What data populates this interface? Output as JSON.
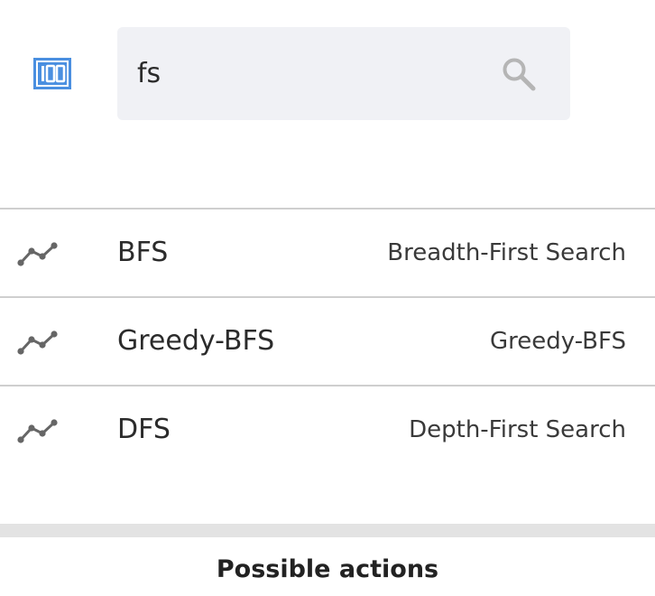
{
  "search": {
    "value": "fs",
    "placeholder": ""
  },
  "results": [
    {
      "name": "BFS",
      "description": "Breadth-First Search"
    },
    {
      "name": "Greedy-BFS",
      "description": "Greedy-BFS"
    },
    {
      "name": "DFS",
      "description": "Depth-First Search"
    }
  ],
  "footer": {
    "title": "Possible actions"
  },
  "colors": {
    "accent": "#4a8fe0",
    "icon_gray": "#666666",
    "search_bg": "#f0f1f5"
  },
  "icons": {
    "app": "counter-100-icon",
    "search": "search-icon",
    "row": "line-chart-icon"
  }
}
